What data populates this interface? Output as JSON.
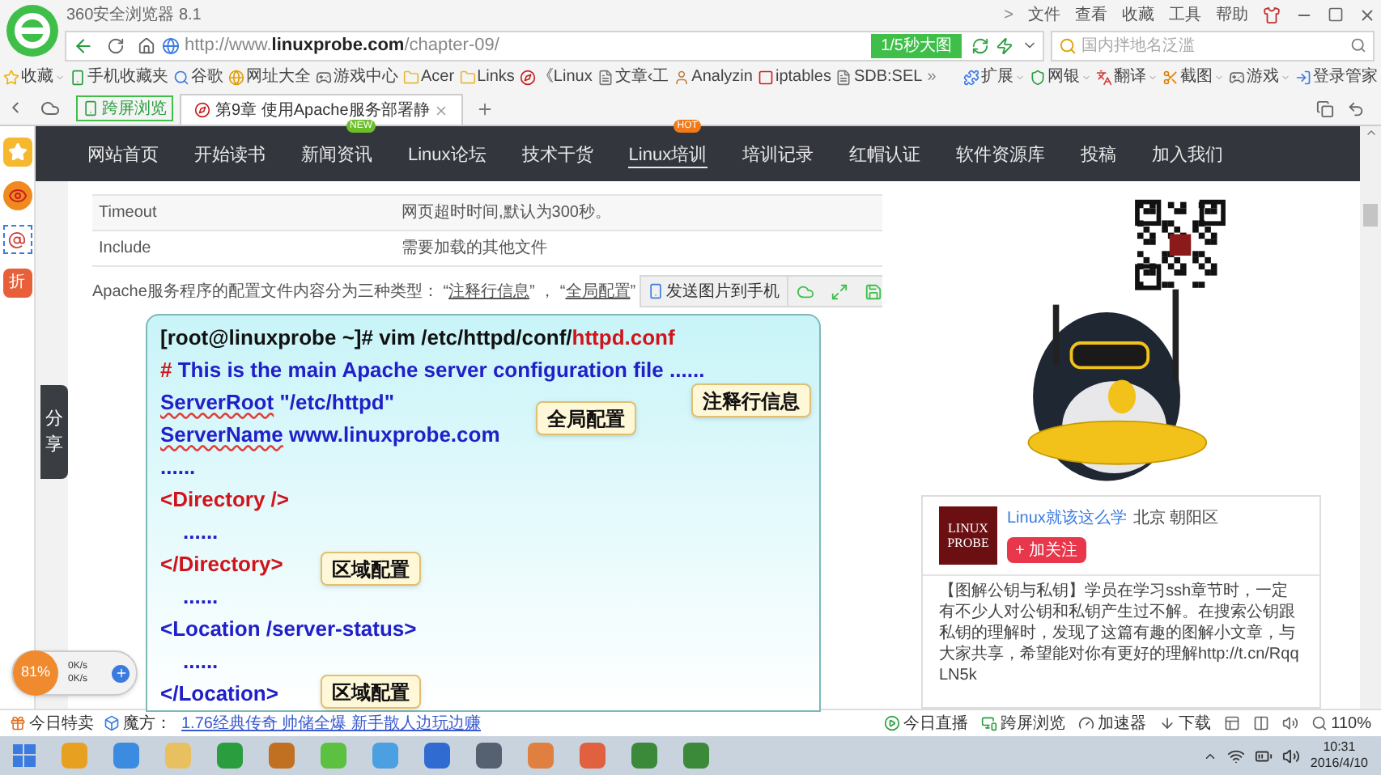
{
  "browser": {
    "title": "360安全浏览器 8.1",
    "menu_arrow": ">",
    "menu": [
      "文件",
      "查看",
      "收藏",
      "工具",
      "帮助"
    ],
    "url": {
      "prefix": "http://www.",
      "host": "linuxprobe.com",
      "path": "/chapter-09/"
    },
    "speed_badge": "1/5秒大图",
    "search": {
      "placeholder": "国内拌地名泛滥"
    }
  },
  "bookmarks": [
    {
      "kind": "favorites",
      "label": "收藏",
      "dropdown": true
    },
    {
      "kind": "phone",
      "label": "手机收藏夹",
      "dropdown": false
    },
    {
      "kind": "search",
      "label": "谷歌",
      "dropdown": false
    },
    {
      "kind": "site",
      "label": "网址大全",
      "dropdown": false
    },
    {
      "kind": "game",
      "label": "游戏中心",
      "dropdown": false
    },
    {
      "kind": "folder",
      "label": "Acer",
      "dropdown": false
    },
    {
      "kind": "folder",
      "label": "Links",
      "dropdown": false
    },
    {
      "kind": "hat",
      "label": "《Linux",
      "dropdown": false
    },
    {
      "kind": "page",
      "label": "文章‹工",
      "dropdown": false
    },
    {
      "kind": "person",
      "label": "Analyzin",
      "dropdown": false
    },
    {
      "kind": "app",
      "label": "iptables",
      "dropdown": false
    },
    {
      "kind": "page",
      "label": "SDB:SEL",
      "dropdown": false
    }
  ],
  "bookmarks_more": "»",
  "tools": [
    {
      "kind": "extension",
      "label": "扩展",
      "dropdown": true
    },
    {
      "kind": "bank",
      "label": "网银",
      "dropdown": true
    },
    {
      "kind": "translate",
      "label": "翻译",
      "dropdown": true
    },
    {
      "kind": "screenshot",
      "label": "截图",
      "dropdown": true
    },
    {
      "kind": "game",
      "label": "游戏",
      "dropdown": true
    },
    {
      "kind": "login",
      "label": "登录管家",
      "dropdown": false
    }
  ],
  "tabs": {
    "cross_screen": "跨屏浏览",
    "items": [
      {
        "title": "第9章 使用Apache服务部署静",
        "selected": true
      }
    ]
  },
  "left_rail": [
    {
      "kind": "favorite"
    },
    {
      "kind": "weibo"
    },
    {
      "kind": "at"
    },
    {
      "kind": "discount",
      "label": "折"
    }
  ],
  "share_tab": "分享",
  "site_nav": [
    {
      "label": "网站首页",
      "selected": false
    },
    {
      "label": "开始读书",
      "selected": false
    },
    {
      "label": "新闻资讯",
      "selected": false,
      "badge": "NEW",
      "color": "#6cbf2a"
    },
    {
      "label": "Linux论坛",
      "selected": false
    },
    {
      "label": "技术干货",
      "selected": false
    },
    {
      "label": "Linux培训",
      "selected": true,
      "badge": "HOT",
      "color": "#f07a1a"
    },
    {
      "label": "培训记录",
      "selected": false
    },
    {
      "label": "红帽认证",
      "selected": false
    },
    {
      "label": "软件资源库",
      "selected": false
    },
    {
      "label": "投稿",
      "selected": false
    },
    {
      "label": "加入我们",
      "selected": false
    }
  ],
  "config_table": [
    {
      "name": "Timeout",
      "description": "网页超时时间,默认为300秒。"
    },
    {
      "name": "Include",
      "description": "需要加载的其他文件"
    }
  ],
  "intro": [
    {
      "text": "Apache服务程序的配置文件内容分为三种类型： “",
      "underline": false
    },
    {
      "text": "注释行信息",
      "underline": true
    },
    {
      "text": "” ， “",
      "underline": false
    },
    {
      "text": "全局配置",
      "underline": true
    },
    {
      "text": "”",
      "underline": false
    }
  ],
  "image_toolbar": {
    "send": "发送图片到手机"
  },
  "code": [
    {
      "kind": "command",
      "text": "[root@linuxprobe ~]# vim /etc/httpd/conf/",
      "file": "httpd.conf"
    },
    {
      "kind": "comment",
      "mark": "#",
      "text": "This is the main Apache server configuration file ......"
    },
    {
      "kind": "directive",
      "name": "ServerRoot",
      "value": "\"/etc/httpd\""
    },
    {
      "kind": "directive",
      "name": "ServerName",
      "value": "www.linuxprobe.com"
    },
    {
      "kind": "ellipsis",
      "text": "......"
    },
    {
      "kind": "tag",
      "text": "<Directory  />",
      "color": "#d0141c"
    },
    {
      "kind": "nested-ellipsis",
      "text": "......"
    },
    {
      "kind": "tag",
      "text": "</Directory>",
      "color": "#d0141c"
    },
    {
      "kind": "nested-ellipsis",
      "text": "......"
    },
    {
      "kind": "tag",
      "text": "<Location /server-status>",
      "color": "#2020c8"
    },
    {
      "kind": "nested-ellipsis",
      "text": "......"
    },
    {
      "kind": "tag",
      "text": "</Location>",
      "color": "#2020c8"
    }
  ],
  "callouts": [
    "注释行信息",
    "全局配置",
    "区域配置",
    "区域配置"
  ],
  "weibo_card": {
    "logo": [
      "LINUX",
      "PROBE"
    ],
    "name": "Linux就该这么学",
    "location": "北京 朝阳区",
    "follow": "+ 加关注",
    "post": "【图解公钥与私钥】学员在学习ssh章节时，一定有不少人对公钥和私钥产生过不解。在搜索公钥跟私钥的理解时，发现了这篇有趣的图解小文章，与大家共享，希望能对你有更好的理解http://t.cn/RqqLN5k"
  },
  "speed_widget": {
    "percent": "81%",
    "up": "0K/s",
    "down": "0K/s"
  },
  "status_bar": {
    "left": [
      {
        "kind": "sale",
        "label": "今日特卖"
      },
      {
        "kind": "cube",
        "label": "魔方："
      }
    ],
    "link": "1.76经典传奇 帅储全爆 新手散人边玩边赚",
    "right": [
      {
        "kind": "live",
        "label": "今日直播"
      },
      {
        "kind": "cross",
        "label": "跨屏浏览"
      },
      {
        "kind": "accelerator",
        "label": "加速器"
      },
      {
        "kind": "download",
        "label": "下载"
      }
    ],
    "zoom": "110%"
  },
  "taskbar": {
    "time": "10:31",
    "date": "2016/4/10"
  }
}
